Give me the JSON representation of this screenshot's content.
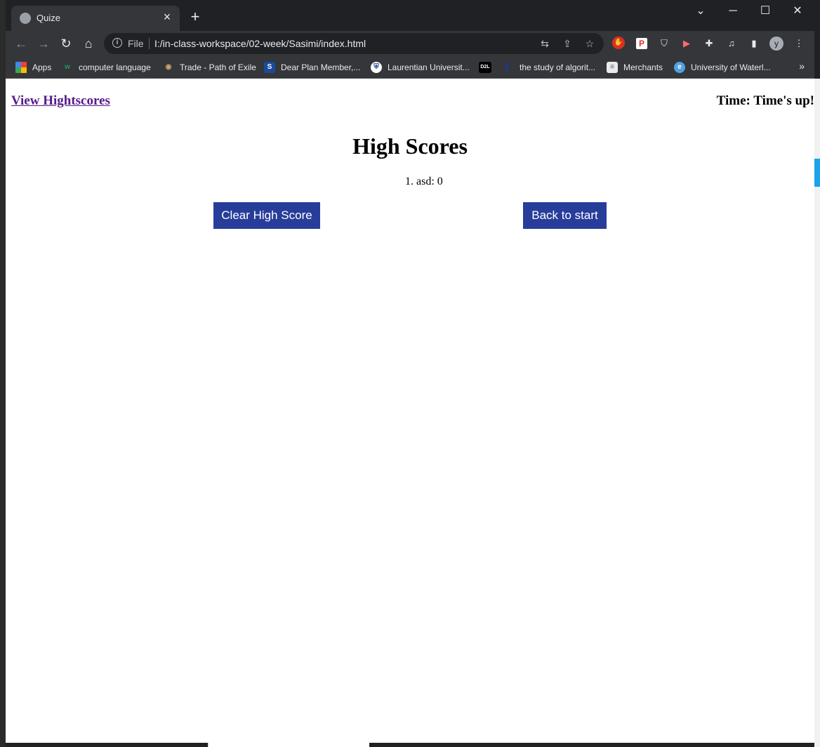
{
  "browser": {
    "tab_title": "Quize",
    "new_tab_symbol": "+",
    "scheme_label": "File",
    "url": "I:/in-class-workspace/02-week/Sasimi/index.html",
    "profile_initial": "y"
  },
  "bookmarks": [
    {
      "label": "Apps",
      "icon": "apps-grid-icon"
    },
    {
      "label": "computer language",
      "icon": "w-site-icon"
    },
    {
      "label": "Trade - Path of Exile",
      "icon": "eye-icon"
    },
    {
      "label": "Dear Plan Member,...",
      "icon": "s-site-icon"
    },
    {
      "label": "Laurentian Universit...",
      "icon": "shield-crest-icon"
    },
    {
      "label": "",
      "icon": "d2l-icon",
      "icon_text": "D2L"
    },
    {
      "label": "the study of algorit...",
      "icon": "bookmark-icon"
    },
    {
      "label": "Merchants",
      "icon": "document-icon"
    },
    {
      "label": "University of Waterl...",
      "icon": "globe-icon"
    }
  ],
  "page": {
    "view_highscores_link": "View Hightscores",
    "timer_text": "Time: Time's up!",
    "heading": "High Scores",
    "scores": [
      "1. asd: 0"
    ],
    "clear_button": "Clear High Score",
    "back_button": "Back to start"
  },
  "colors": {
    "button_bg": "#283d9a",
    "visited_link": "#551a8b",
    "chrome_dark": "#202124",
    "chrome_toolbar": "#35363a"
  }
}
